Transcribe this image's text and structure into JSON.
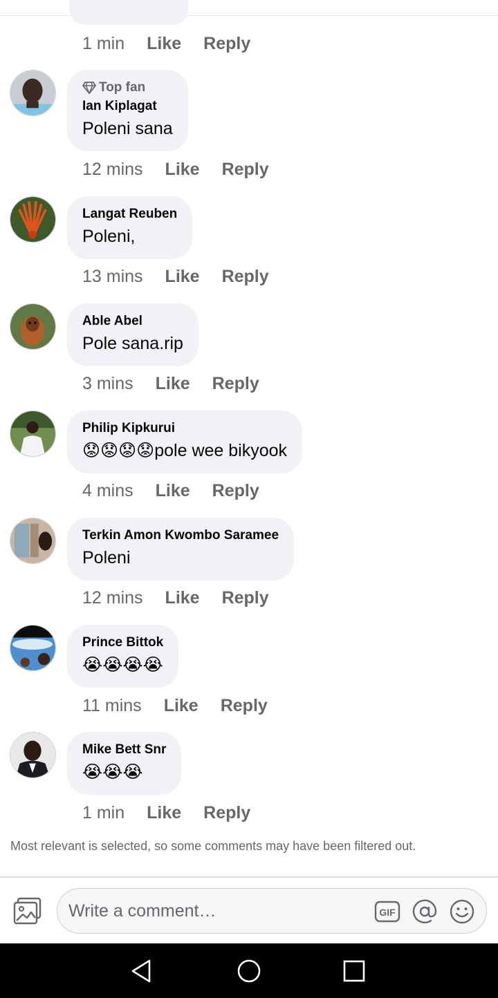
{
  "comments": [
    {
      "top_fan": "",
      "name": "",
      "text": "",
      "time": "1 min",
      "like": "Like",
      "reply": "Reply"
    },
    {
      "top_fan": "Top fan",
      "name": "Ian Kiplagat",
      "text": "Poleni sana",
      "time": "12 mins",
      "like": "Like",
      "reply": "Reply"
    },
    {
      "name": "Langat Reuben",
      "text": "Poleni,",
      "time": "13 mins",
      "like": "Like",
      "reply": "Reply"
    },
    {
      "name": "Able Abel",
      "text": "Pole sana.rip",
      "time": "3 mins",
      "like": "Like",
      "reply": "Reply"
    },
    {
      "name": "Philip Kipkurui",
      "text": "😟😟😟😟pole wee bikyook",
      "time": "4 mins",
      "like": "Like",
      "reply": "Reply"
    },
    {
      "name": "Terkin Amon Kwombo Saramee",
      "text": "Poleni",
      "time": "12 mins",
      "like": "Like",
      "reply": "Reply"
    },
    {
      "name": "Prince Bittok",
      "text": "😭😭😭😭",
      "time": "11 mins",
      "like": "Like",
      "reply": "Reply"
    },
    {
      "name": "Mike Bett Snr",
      "text": "😭😭😭",
      "time": "1 min",
      "like": "Like",
      "reply": "Reply"
    }
  ],
  "filter_note": "Most relevant is selected, so some comments may have been filtered out.",
  "composer": {
    "placeholder": "Write a comment…",
    "icons": [
      "photo-icon",
      "gif-icon",
      "mention-icon",
      "emoji-icon"
    ]
  },
  "navigation": {
    "icons": [
      "back-icon",
      "home-icon",
      "recents-icon"
    ]
  },
  "colors": {
    "bubble": "#f0f2f5",
    "meta_text": "#65676b",
    "name_text": "#050505",
    "nav_bar": "#000000"
  }
}
